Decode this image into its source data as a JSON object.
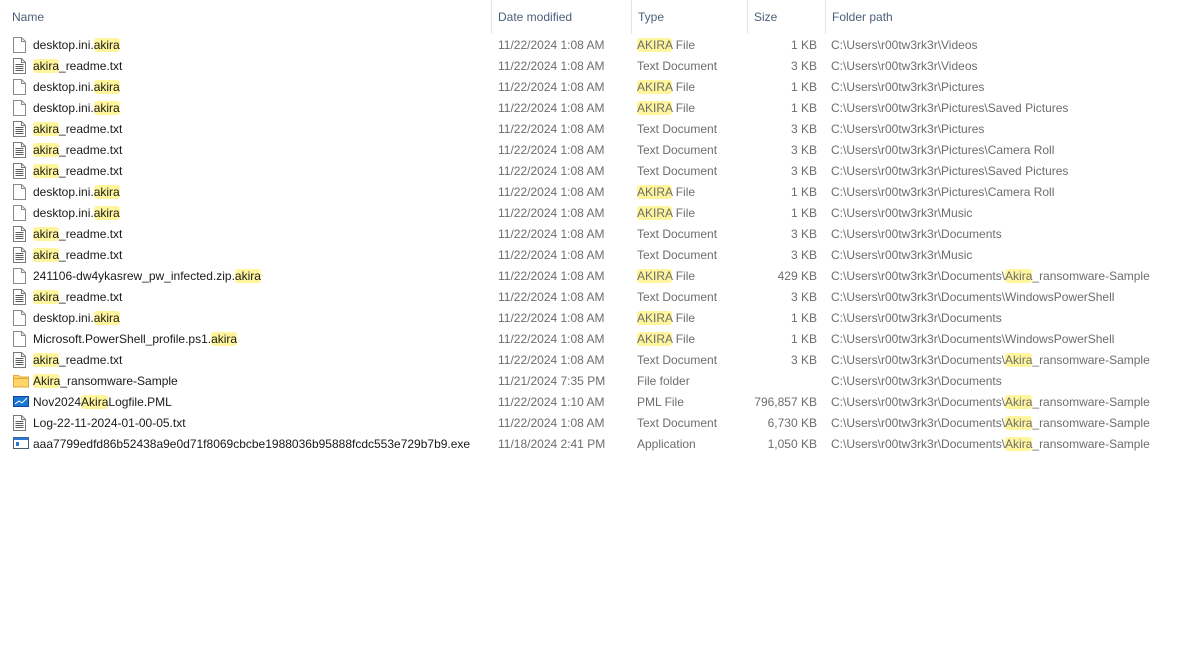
{
  "columns": {
    "name": "Name",
    "date": "Date modified",
    "type": "Type",
    "size": "Size",
    "path": "Folder path"
  },
  "files": [
    {
      "icon": "blank-file-icon",
      "name": "desktop.ini.akira",
      "date": "11/22/2024 1:08 AM",
      "type": "AKIRA File",
      "size": "1 KB",
      "path": "C:\\Users\\r00tw3rk3r\\Videos"
    },
    {
      "icon": "text-file-icon",
      "name": "akira_readme.txt",
      "date": "11/22/2024 1:08 AM",
      "type": "Text Document",
      "size": "3 KB",
      "path": "C:\\Users\\r00tw3rk3r\\Videos"
    },
    {
      "icon": "blank-file-icon",
      "name": "desktop.ini.akira",
      "date": "11/22/2024 1:08 AM",
      "type": "AKIRA File",
      "size": "1 KB",
      "path": "C:\\Users\\r00tw3rk3r\\Pictures"
    },
    {
      "icon": "blank-file-icon",
      "name": "desktop.ini.akira",
      "date": "11/22/2024 1:08 AM",
      "type": "AKIRA File",
      "size": "1 KB",
      "path": "C:\\Users\\r00tw3rk3r\\Pictures\\Saved Pictures"
    },
    {
      "icon": "text-file-icon",
      "name": "akira_readme.txt",
      "date": "11/22/2024 1:08 AM",
      "type": "Text Document",
      "size": "3 KB",
      "path": "C:\\Users\\r00tw3rk3r\\Pictures"
    },
    {
      "icon": "text-file-icon",
      "name": "akira_readme.txt",
      "date": "11/22/2024 1:08 AM",
      "type": "Text Document",
      "size": "3 KB",
      "path": "C:\\Users\\r00tw3rk3r\\Pictures\\Camera Roll"
    },
    {
      "icon": "text-file-icon",
      "name": "akira_readme.txt",
      "date": "11/22/2024 1:08 AM",
      "type": "Text Document",
      "size": "3 KB",
      "path": "C:\\Users\\r00tw3rk3r\\Pictures\\Saved Pictures"
    },
    {
      "icon": "blank-file-icon",
      "name": "desktop.ini.akira",
      "date": "11/22/2024 1:08 AM",
      "type": "AKIRA File",
      "size": "1 KB",
      "path": "C:\\Users\\r00tw3rk3r\\Pictures\\Camera Roll"
    },
    {
      "icon": "blank-file-icon",
      "name": "desktop.ini.akira",
      "date": "11/22/2024 1:08 AM",
      "type": "AKIRA File",
      "size": "1 KB",
      "path": "C:\\Users\\r00tw3rk3r\\Music"
    },
    {
      "icon": "text-file-icon",
      "name": "akira_readme.txt",
      "date": "11/22/2024 1:08 AM",
      "type": "Text Document",
      "size": "3 KB",
      "path": "C:\\Users\\r00tw3rk3r\\Documents"
    },
    {
      "icon": "text-file-icon",
      "name": "akira_readme.txt",
      "date": "11/22/2024 1:08 AM",
      "type": "Text Document",
      "size": "3 KB",
      "path": "C:\\Users\\r00tw3rk3r\\Music"
    },
    {
      "icon": "blank-file-icon",
      "name": "241106-dw4ykasrew_pw_infected.zip.akira",
      "date": "11/22/2024 1:08 AM",
      "type": "AKIRA File",
      "size": "429 KB",
      "path": "C:\\Users\\r00tw3rk3r\\Documents\\Akira_ransomware-Sample"
    },
    {
      "icon": "text-file-icon",
      "name": "akira_readme.txt",
      "date": "11/22/2024 1:08 AM",
      "type": "Text Document",
      "size": "3 KB",
      "path": "C:\\Users\\r00tw3rk3r\\Documents\\WindowsPowerShell"
    },
    {
      "icon": "blank-file-icon",
      "name": "desktop.ini.akira",
      "date": "11/22/2024 1:08 AM",
      "type": "AKIRA File",
      "size": "1 KB",
      "path": "C:\\Users\\r00tw3rk3r\\Documents"
    },
    {
      "icon": "blank-file-icon",
      "name": "Microsoft.PowerShell_profile.ps1.akira",
      "date": "11/22/2024 1:08 AM",
      "type": "AKIRA File",
      "size": "1 KB",
      "path": "C:\\Users\\r00tw3rk3r\\Documents\\WindowsPowerShell"
    },
    {
      "icon": "text-file-icon",
      "name": "akira_readme.txt",
      "date": "11/22/2024 1:08 AM",
      "type": "Text Document",
      "size": "3 KB",
      "path": "C:\\Users\\r00tw3rk3r\\Documents\\Akira_ransomware-Sample"
    },
    {
      "icon": "folder-icon",
      "name": "Akira_ransomware-Sample",
      "date": "11/21/2024 7:35 PM",
      "type": "File folder",
      "size": "",
      "path": "C:\\Users\\r00tw3rk3r\\Documents"
    },
    {
      "icon": "pml-file-icon",
      "name": "Nov2024AkiraLogfile.PML",
      "date": "11/22/2024 1:10 AM",
      "type": "PML File",
      "size": "796,857 KB",
      "path": "C:\\Users\\r00tw3rk3r\\Documents\\Akira_ransomware-Sample"
    },
    {
      "icon": "text-file-icon",
      "name": "Log-22-11-2024-01-00-05.txt",
      "date": "11/22/2024 1:08 AM",
      "type": "Text Document",
      "size": "6,730 KB",
      "path": "C:\\Users\\r00tw3rk3r\\Documents\\Akira_ransomware-Sample"
    },
    {
      "icon": "application-icon",
      "name": "aaa7799edfd86b52438a9e0d71f8069cbcbe1988036b95888fcdc553e729b7b9.exe",
      "date": "11/18/2024 2:41 PM",
      "type": "Application",
      "size": "1,050 KB",
      "path": "C:\\Users\\r00tw3rk3r\\Documents\\Akira_ransomware-Sample"
    }
  ],
  "search_highlight": {
    "term": "akira",
    "color": "#fff59d"
  }
}
